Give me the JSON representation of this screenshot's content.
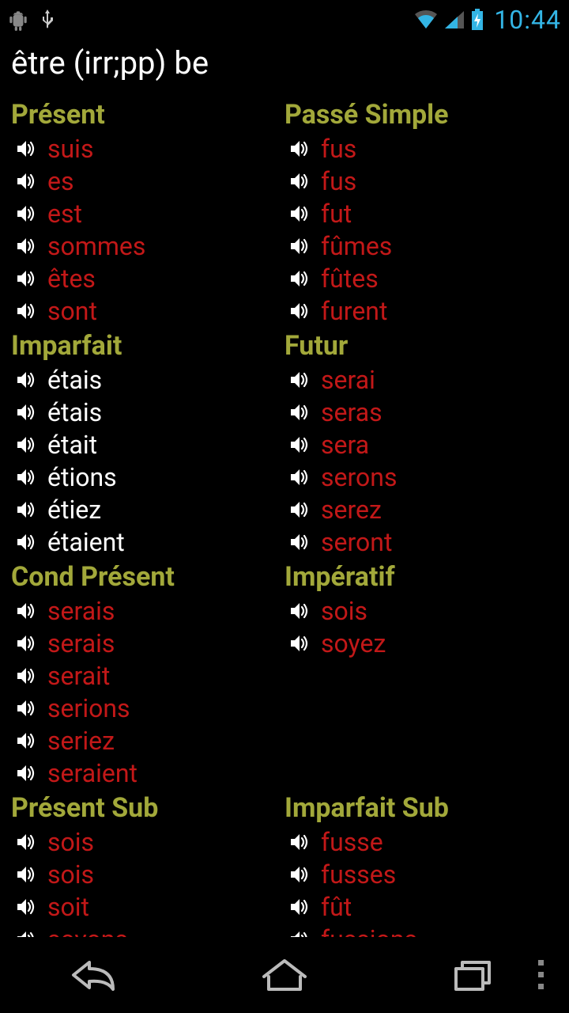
{
  "status": {
    "time": "10:44"
  },
  "title": "être (irr;pp) be",
  "columns": [
    [
      {
        "header": "Présent",
        "color": "red",
        "items": [
          "suis",
          "es",
          "est",
          "sommes",
          "êtes",
          "sont"
        ]
      },
      {
        "header": "Imparfait",
        "color": "white",
        "items": [
          "étais",
          "étais",
          "était",
          "étions",
          "étiez",
          "étaient"
        ]
      },
      {
        "header": "Cond Présent",
        "color": "red",
        "items": [
          "serais",
          "serais",
          "serait",
          "serions",
          "seriez",
          "seraient"
        ]
      },
      {
        "header": "Présent Sub",
        "color": "red",
        "items": [
          "sois",
          "sois",
          "soit",
          "soyons"
        ]
      }
    ],
    [
      {
        "header": "Passé Simple",
        "color": "red",
        "items": [
          "fus",
          "fus",
          "fut",
          "fûmes",
          "fûtes",
          "furent"
        ]
      },
      {
        "header": "Futur",
        "color": "red",
        "items": [
          "serai",
          "seras",
          "sera",
          "serons",
          "serez",
          "seront"
        ]
      },
      {
        "header": "Impératif",
        "color": "red",
        "items": [
          "sois",
          "soyez"
        ]
      },
      {
        "header": "Imparfait Sub",
        "color": "red",
        "items": [
          "fusse",
          "fusses",
          "fût",
          "fussions"
        ]
      }
    ]
  ]
}
